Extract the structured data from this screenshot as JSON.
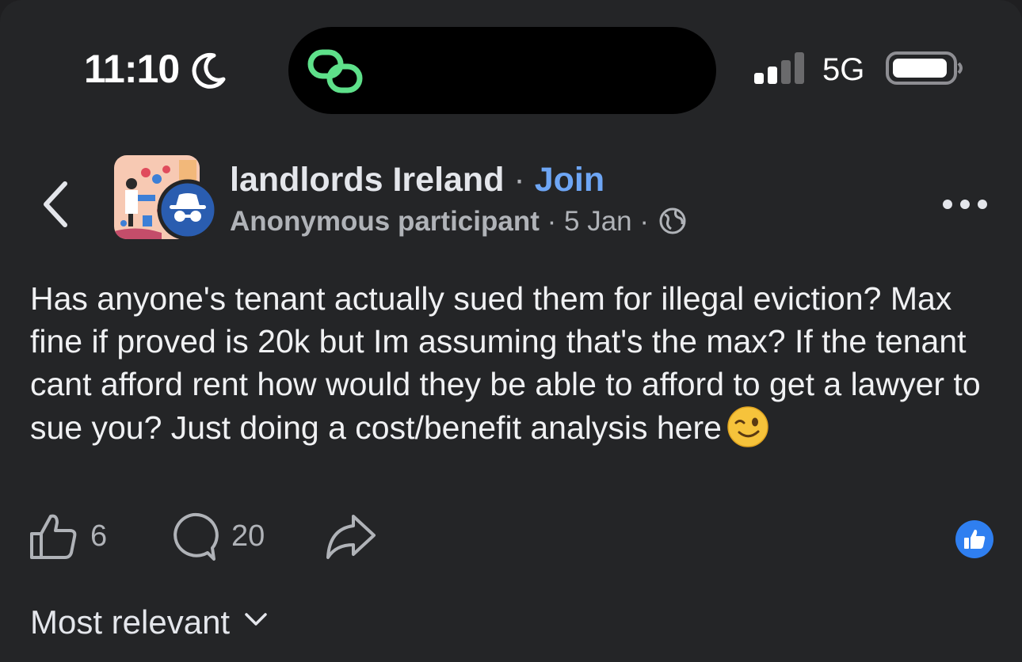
{
  "status_bar": {
    "time": "11:10",
    "network": "5G",
    "icons": [
      "moon-icon",
      "link-icon",
      "signal-icon",
      "battery-icon"
    ]
  },
  "post": {
    "group_name": "landlords Ireland",
    "separator": "·",
    "join_label": "Join",
    "author": "Anonymous participant",
    "date": "5 Jan",
    "privacy_icon": "globe-icon",
    "text": "Has anyone's tenant actually sued them for illegal eviction? Max fine if proved is 20k but Im assuming that's the max? If the tenant cant afford rent how would they be able to afford to get a lawyer to sue you? Just doing a cost/benefit analysis here",
    "emoji": "winking-face"
  },
  "actions": {
    "like_count": "6",
    "comment_count": "20"
  },
  "comments": {
    "sort_label": "Most relevant"
  },
  "colors": {
    "background": "#242527",
    "accent": "#6ea6f5",
    "secondary_text": "#b0b3b8",
    "like_badge": "#2f7ff0",
    "link_icon": "#5ee08a"
  }
}
